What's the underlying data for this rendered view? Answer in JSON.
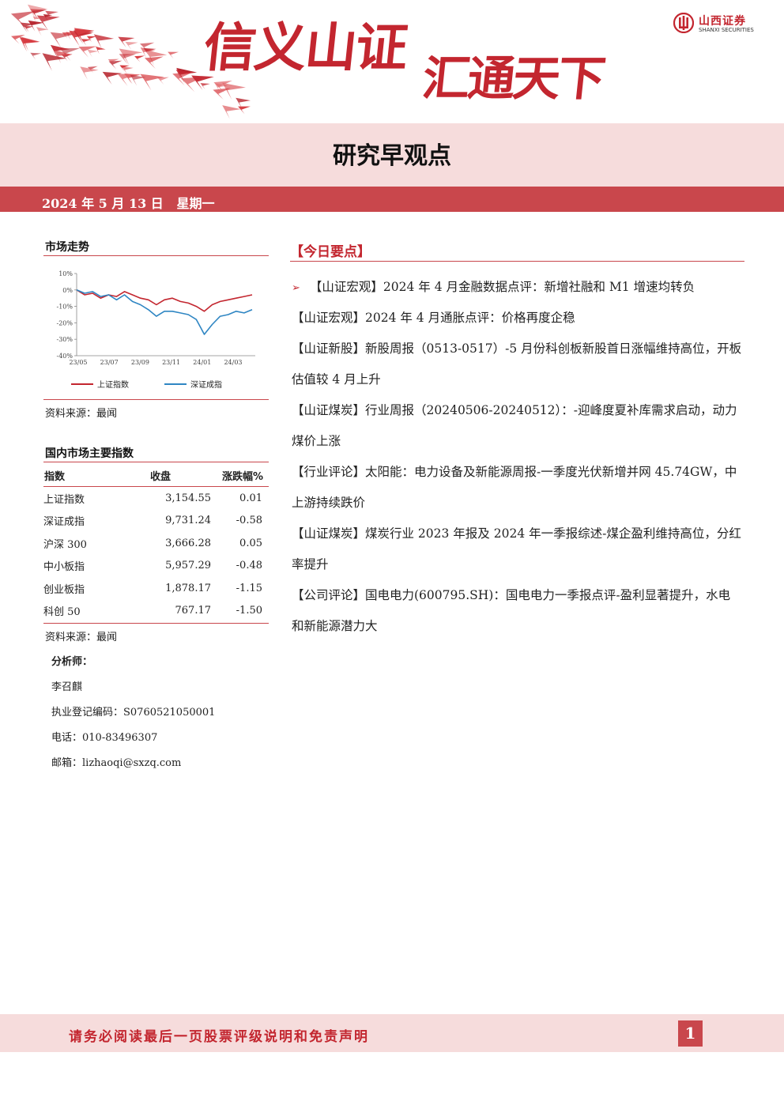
{
  "header": {
    "slogan_part1": "信义山证",
    "slogan_part2": "汇通天下",
    "brand_cn": "山西证券",
    "brand_en": "SHANXI SECURITIES",
    "page_title": "研究早观点",
    "date": "2024 年 5 月 13 日   星期一"
  },
  "market_trend": {
    "title": "市场走势",
    "source": "资料来源：最闻",
    "chart_data": {
      "type": "line",
      "x": [
        "23/05",
        "23/07",
        "23/09",
        "23/11",
        "24/01",
        "24/03"
      ],
      "ylim": [
        -40,
        10
      ],
      "yticks": [
        "10%",
        "0%",
        "-10%",
        "-20%",
        "-30%",
        "-40%"
      ],
      "series": [
        {
          "name": "上证指数",
          "color": "#c3262f",
          "values": [
            0,
            -3,
            -2,
            -5,
            -3,
            -4,
            -1,
            -3,
            -5,
            -6,
            -9,
            -6,
            -5,
            -7,
            -8,
            -10,
            -13,
            -9,
            -7,
            -6,
            -5,
            -4,
            -3
          ]
        },
        {
          "name": "深证成指",
          "color": "#2f86c3",
          "values": [
            0,
            -2,
            -1,
            -4,
            -3,
            -6,
            -3,
            -7,
            -9,
            -12,
            -16,
            -13,
            -13,
            -14,
            -15,
            -18,
            -27,
            -21,
            -16,
            -15,
            -13,
            -14,
            -12
          ]
        }
      ]
    }
  },
  "indices": {
    "title": "国内市场主要指数",
    "headers": [
      "指数",
      "收盘",
      "涨跌幅%"
    ],
    "rows": [
      [
        "上证指数",
        "3,154.55",
        "0.01"
      ],
      [
        "深证成指",
        "9,731.24",
        "-0.58"
      ],
      [
        "沪深 300",
        "3,666.28",
        "0.05"
      ],
      [
        "中小板指",
        "5,957.29",
        "-0.48"
      ],
      [
        "创业板指",
        "1,878.17",
        "-1.15"
      ],
      [
        "科创 50",
        "767.17",
        "-1.50"
      ]
    ],
    "source": "资料来源：最闻"
  },
  "analyst": {
    "label": "分析师：",
    "name": "李召麒",
    "license": "执业登记编码：S0760521050001",
    "phone": "电话：010-83496307",
    "email": "邮箱：lizhaoqi@sxzq.com"
  },
  "today": {
    "title": "【今日要点】",
    "items": [
      "【山证宏观】2024 年 4 月金融数据点评：新增社融和 M1 增速均转负",
      "【山证宏观】2024 年 4 月通胀点评：价格再度企稳",
      "【山证新股】新股周报（0513-0517）-5 月份科创板新股首日涨幅维持高位，开板估值较 4 月上升",
      "【山证煤炭】行业周报（20240506-20240512）：-迎峰度夏补库需求启动，动力煤价上涨",
      "【行业评论】太阳能：电力设备及新能源周报-一季度光伏新增并网 45.74GW，中上游持续跌价",
      "【山证煤炭】煤炭行业 2023 年报及 2024 年一季报综述-煤企盈利维持高位，分红率提升",
      "【公司评论】国电电力(600795.SH)：国电电力一季报点评-盈利显著提升，水电和新能源潜力大"
    ]
  },
  "footer": {
    "notice": "请务必阅读最后一页股票评级说明和免责声明",
    "page": "1"
  }
}
